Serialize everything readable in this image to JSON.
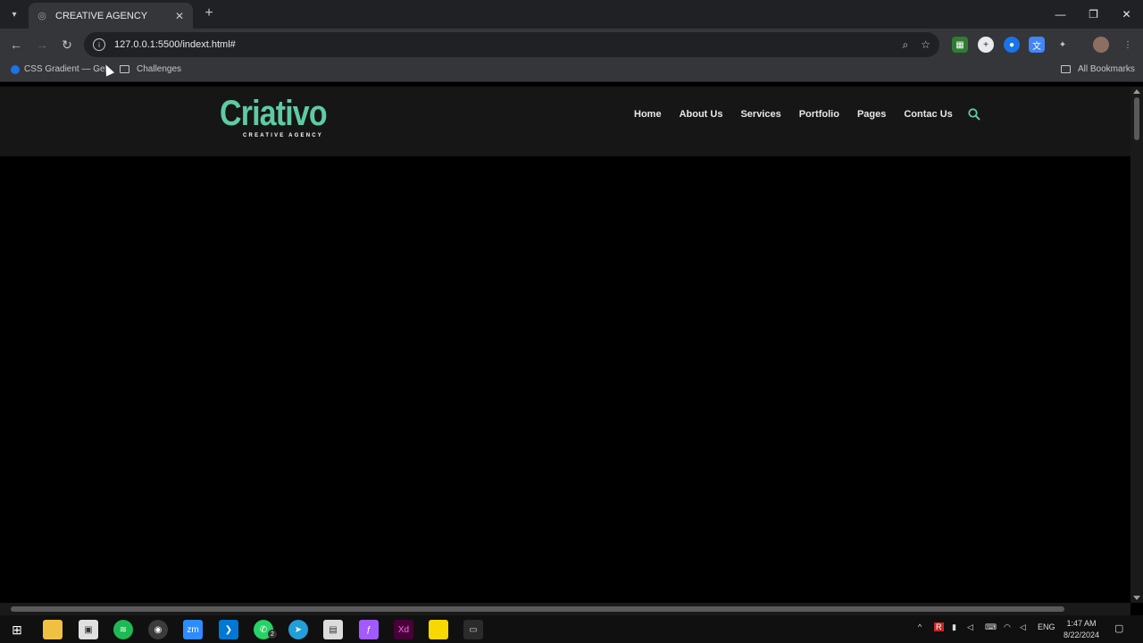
{
  "browser": {
    "tab_title": "CREATIVE AGENCY",
    "url": "127.0.0.1:5500/indext.html#",
    "bookmarks": [
      {
        "label": "CSS Gradient — Ge..."
      },
      {
        "label": "Challenges"
      }
    ],
    "all_bookmarks": "All Bookmarks"
  },
  "site": {
    "logo_main": "Criativo",
    "logo_sub": "CREATIVE AGENCY",
    "nav": [
      "Home",
      "About Us",
      "Services",
      "Portfolio",
      "Pages",
      "Contac Us"
    ]
  },
  "taskbar": {
    "time": "1:47 AM",
    "date": "8/22/2024",
    "lang": "ENG",
    "whatsapp_badge": "2",
    "zoom_label": "zm",
    "xd_label": "Xd"
  },
  "colors": {
    "accent": "#5ecba3",
    "header_bg": "#161616",
    "page_bg": "#000000"
  }
}
